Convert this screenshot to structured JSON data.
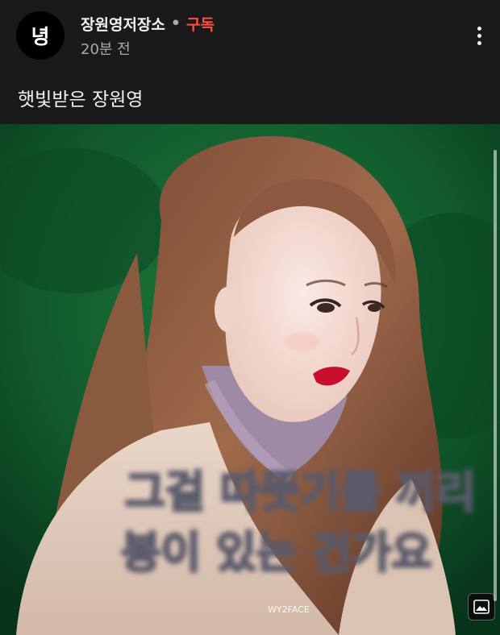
{
  "post": {
    "avatar_text": "녕",
    "channel_name": "장원영저장소",
    "separator": "•",
    "subscribe_label": "구독",
    "time_ago": "20분 전",
    "text": "햇빛받은 장원영",
    "more_icon": "more-vertical-icon"
  },
  "image": {
    "watermark": "WY2FACE",
    "caption_line1": "그걸 따뜻기를 끼리",
    "caption_line2": "봉이 있는 건가요",
    "badge_icon": "image-gallery-icon"
  },
  "colors": {
    "background": "#1a1a1a",
    "subscribe": "#ff4e45",
    "secondary_text": "#aaaaaa",
    "image_bg": "#0f5a2a"
  }
}
